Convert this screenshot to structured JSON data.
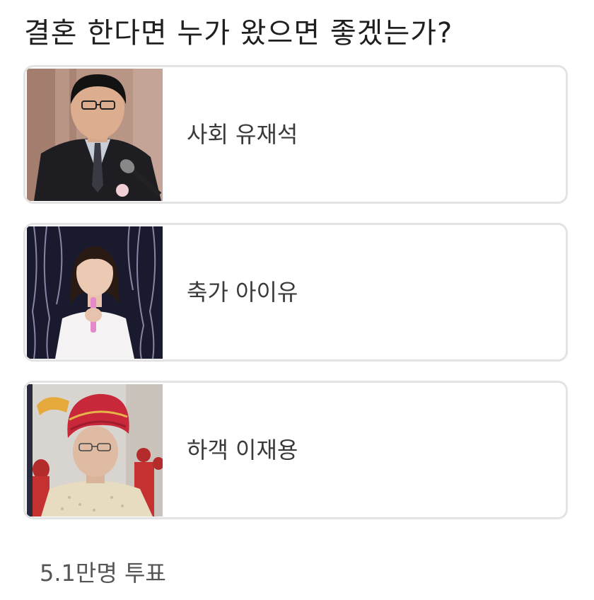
{
  "poll": {
    "question": "결혼 한다면 누가 왔으면 좋겠는가?",
    "options": [
      {
        "label": "사회 유재석",
        "image": "person-at-microphone-photo"
      },
      {
        "label": "축가 아이유",
        "image": "singer-with-microphone-photo"
      },
      {
        "label": "하객 이재용",
        "image": "man-in-red-turban-photo"
      }
    ],
    "vote_count": "5.1만명 투표"
  },
  "colors": {
    "card_border": "#e3e3e3",
    "text_primary": "#1f1f1f",
    "text_secondary": "#555555"
  }
}
